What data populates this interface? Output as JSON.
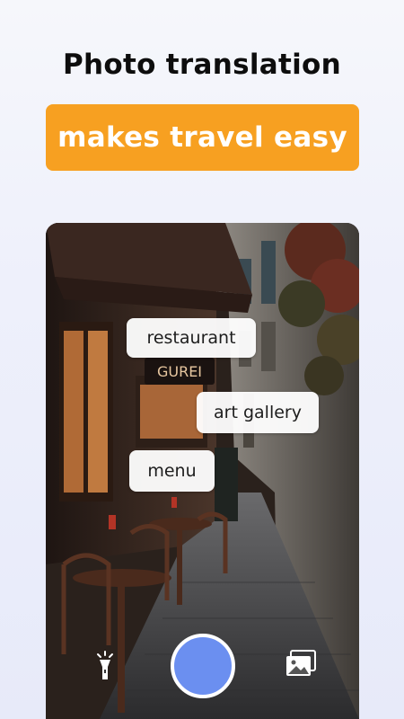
{
  "headline": "Photo translation",
  "banner": "makes travel easy",
  "camera": {
    "labels": {
      "restaurant": "restaurant",
      "art_gallery": "art gallery",
      "menu": "menu"
    },
    "shop_sign": "GUREI",
    "controls": {
      "flash_icon": "flashlight-icon",
      "shutter": "shutter-button",
      "gallery_icon": "gallery-icon"
    }
  },
  "colors": {
    "banner_bg": "#f7a021",
    "shutter": "#6b8ff0",
    "headline": "#0d0d0d"
  }
}
